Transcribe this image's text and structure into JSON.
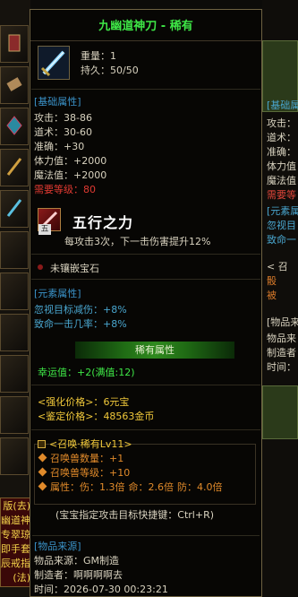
{
  "background": {
    "left_red_panel_lines": [
      "版(去)",
      "幽道神",
      "专翠琼",
      "即手套",
      "辰戒指",
      "(法)"
    ],
    "right_lines": {
      "basic_attr": "[基础属",
      "attack": "攻击：",
      "taoism": "道术：",
      "accuracy": "准确：",
      "hp": "体力值：",
      "mp": "魔法值：",
      "req_level": "需要等",
      "element_attr": "[元素属",
      "element_1": "忽视目",
      "element_2": "致命一",
      "summon_1": "< 召",
      "summon_2": "骰",
      "summon_3": "被",
      "source": "[物品来",
      "src_1": "物品来",
      "src_2": "制造者",
      "src_3": "时间："
    }
  },
  "tooltip": {
    "title": "九幽道神刀 - 稀有",
    "weight_label": "重量：",
    "weight_value": "1",
    "durability_label": "持久：",
    "durability_value": "50/50",
    "basic_header": "[基础属性]",
    "attack_label": "攻击：",
    "attack_value": "38-86",
    "taoism_label": "道术：",
    "taoism_value": "30-60",
    "accuracy_label": "准确：",
    "accuracy_value": "+30",
    "hp_label": "体力值：",
    "hp_value": "+2000",
    "mp_label": "魔法值：",
    "mp_value": "+2000",
    "req_level_label": "需要等级：",
    "req_level_value": "80",
    "five_badge": "五",
    "five_title": "五行之力",
    "five_desc": "每攻击3次，下一击伤害提升12%",
    "gem_text": "未镶嵌宝石",
    "element_header": "[元素属性]",
    "element_1_label": "忽视目标减伤：",
    "element_1_value": "+8%",
    "element_2_label": "致命一击几率：",
    "element_2_value": "+8%",
    "rare_bar": "稀有属性",
    "luck_label": "幸运值：",
    "luck_value": "+2(满值:12)",
    "strengthen_label": "<强化价格>：",
    "strengthen_value": "6元宝",
    "appraise_label": "<鉴定价格>：",
    "appraise_value": "48563金币",
    "summon_header": "<召唤·稀有Lv11>",
    "summon_count_label": "召唤兽数量：",
    "summon_count_value": "+1",
    "summon_level_label": "召唤兽等级：",
    "summon_level_value": "+10",
    "summon_attr_label": "属性：",
    "summon_attr_1_label": "伤：",
    "summon_attr_1_value": "1.3倍",
    "summon_attr_2_label": "命：",
    "summon_attr_2_value": "2.6倍",
    "summon_attr_3_label": "防：",
    "summon_attr_3_value": "4.0倍",
    "hotkey_text": "(宝宝指定攻击目标快捷键：Ctrl+R)",
    "source_header": "[物品来源]",
    "source_label": "物品来源：",
    "source_value": "GM制造",
    "maker_label": "制造者：",
    "maker_value": "啊啊啊啊去",
    "time_label": "时间：",
    "time_value": "2026-07-30 00:23:21"
  }
}
